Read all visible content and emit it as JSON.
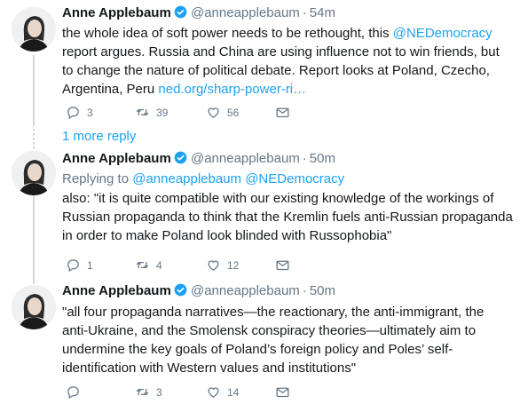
{
  "tweets": [
    {
      "name": "Anne Applebaum",
      "handle": "@anneapplebaum",
      "time": "54m",
      "text_before": "the whole idea of soft power needs to be rethought, this ",
      "mention": "@NEDemocracy",
      "text_after": " report argues. Russia and China are using influence not to win friends, but to change the nature of political debate. Report looks at Poland, Czecho, Argentina, Peru ",
      "url": "ned.org/sharp-power-ri…",
      "replies": "3",
      "retweets": "39",
      "likes": "56"
    },
    {
      "name": "Anne Applebaum",
      "handle": "@anneapplebaum",
      "time": "50m",
      "replying_label": "Replying to ",
      "replying_handles": "@anneapplebaum @NEDemocracy",
      "text": "also: \"it is quite compatible with our existing knowledge of the workings of Russian propaganda to think that the Kremlin fuels anti-Russian propaganda in order to make Poland look blinded with Russophobia\"",
      "replies": "1",
      "retweets": "4",
      "likes": "12"
    },
    {
      "name": "Anne Applebaum",
      "handle": "@anneapplebaum",
      "time": "50m",
      "text": "\"all four propaganda narratives—the reactionary, the anti-immigrant, the anti-Ukraine, and the Smolensk conspiracy theories—ultimately aim to undermine the key goals of Poland’s foreign policy and Poles’ self-identification with Western values and institutions\"",
      "replies": "",
      "retweets": "3",
      "likes": "14"
    }
  ],
  "more_reply": "1 more reply",
  "colors": {
    "link": "#1da1f2",
    "muted": "#657786",
    "thread": "#ccd6dd",
    "verified": "#1da1f2"
  }
}
